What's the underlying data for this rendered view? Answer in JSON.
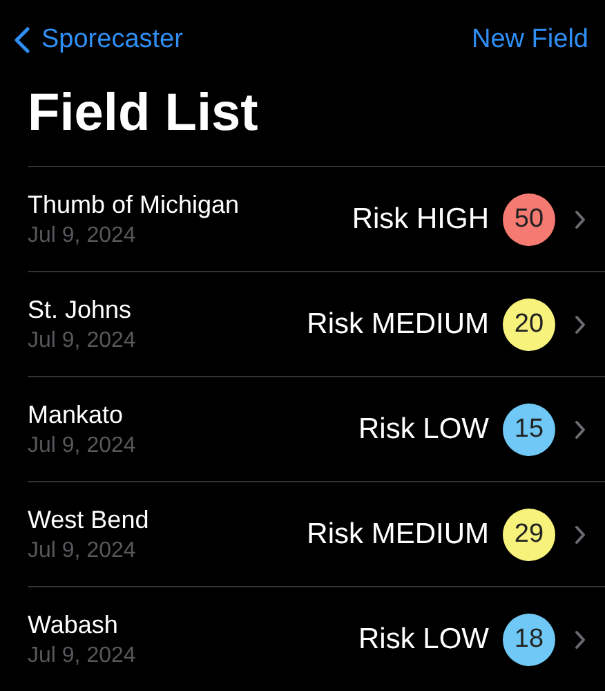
{
  "nav": {
    "back_label": "Sporecaster",
    "action": "New Field"
  },
  "title": "Field List",
  "fields": [
    {
      "name": "Thumb of Michigan",
      "date": "Jul 9, 2024",
      "risk": "Risk HIGH",
      "score": "50",
      "color": "#f47a72"
    },
    {
      "name": "St. Johns",
      "date": "Jul 9, 2024",
      "risk": "Risk MEDIUM",
      "score": "20",
      "color": "#f6f27c"
    },
    {
      "name": "Mankato",
      "date": "Jul 9, 2024",
      "risk": "Risk LOW",
      "score": "15",
      "color": "#6fc8f6"
    },
    {
      "name": "West Bend",
      "date": "Jul 9, 2024",
      "risk": "Risk MEDIUM",
      "score": "29",
      "color": "#f6f27c"
    },
    {
      "name": "Wabash",
      "date": "Jul 9, 2024",
      "risk": "Risk LOW",
      "score": "18",
      "color": "#6fc8f6"
    }
  ]
}
